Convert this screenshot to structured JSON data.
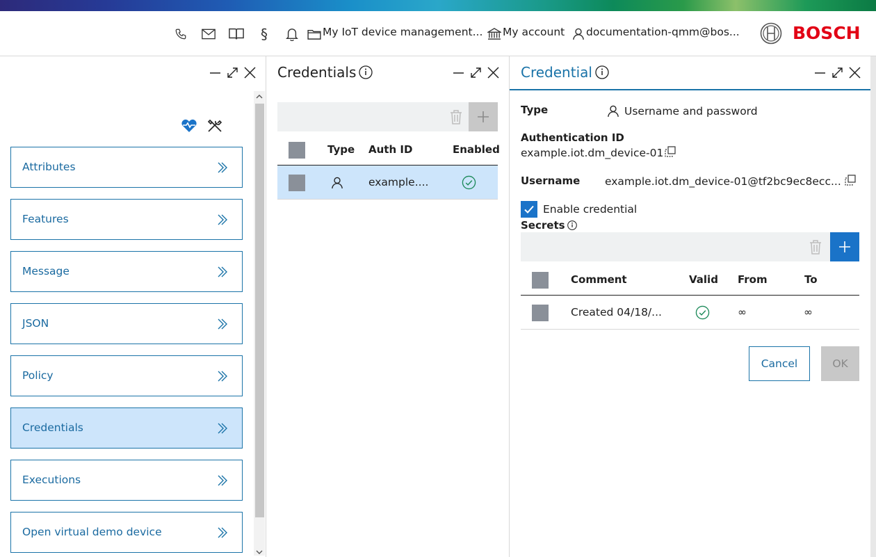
{
  "header": {
    "project": "My IoT device management...",
    "account": "My account",
    "user": "documentation-qmm@bos...",
    "brand": "BOSCH",
    "icons": [
      "phone-icon",
      "mail-icon",
      "book-icon",
      "paragraph-icon",
      "bell-icon",
      "folder-icon",
      "bank-icon",
      "user-icon"
    ],
    "paragraph_glyph": "§"
  },
  "nav": {
    "items": [
      {
        "label": "Attributes",
        "active": false
      },
      {
        "label": "Features",
        "active": false
      },
      {
        "label": "Message",
        "active": false
      },
      {
        "label": "JSON",
        "active": false
      },
      {
        "label": "Policy",
        "active": false
      },
      {
        "label": "Credentials",
        "active": true
      },
      {
        "label": "Executions",
        "active": false
      },
      {
        "label": "Open virtual demo device",
        "active": false
      }
    ]
  },
  "credentials": {
    "title": "Credentials",
    "columns": [
      "Type",
      "Auth ID",
      "Enabled"
    ],
    "rows": [
      {
        "type_icon": "user-icon",
        "auth_id": "example....",
        "enabled": true
      }
    ]
  },
  "credential": {
    "title": "Credential",
    "type_label": "Type",
    "type_value": "Username and password",
    "auth_label": "Authentication ID",
    "auth_value": "example.iot.dm_device-01",
    "username_label": "Username",
    "username_value": "example.iot.dm_device-01@tf2bc9ec8ecc...",
    "enable_label": "Enable credential",
    "enabled": true,
    "secrets_label": "Secrets",
    "secrets_columns": [
      "Comment",
      "Valid",
      "From",
      "To"
    ],
    "secrets_rows": [
      {
        "comment": "Created 04/18/...",
        "valid": true,
        "from": "∞",
        "to": "∞"
      }
    ],
    "cancel_label": "Cancel",
    "ok_label": "OK"
  },
  "colors": {
    "accent": "#1a73a8",
    "active_bg": "#cde5fb",
    "brand_red": "#e20015",
    "valid_green": "#1d8a5a"
  }
}
